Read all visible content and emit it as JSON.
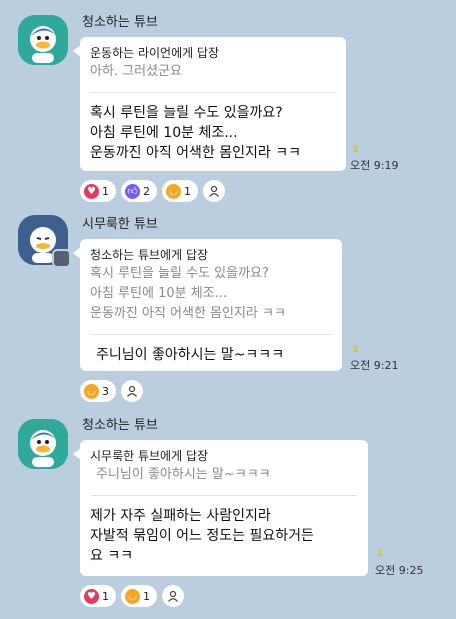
{
  "colors": {
    "background": "#bacee0",
    "bubble": "#ffffff",
    "unread": "#f2c100",
    "heart": "#e8385a",
    "like": "#7a5cf0",
    "laugh": "#f5a623"
  },
  "messages": [
    {
      "sender": "청소하는 튜브",
      "reply_to": "운동하는 라이언에게 답장",
      "quote": [
        "아하. 그러셨군요"
      ],
      "body": [
        "혹시 루틴을 늘릴 수도 있을까요?",
        "아침 루틴에 10분 체조...",
        "운동까진 아직 어색한 몸인지라 ㅋㅋ"
      ],
      "unread": "1",
      "time": "오전 9:19",
      "reactions": [
        {
          "icon": "heart-icon",
          "count": "1"
        },
        {
          "icon": "thumbs-up-icon",
          "count": "2"
        },
        {
          "icon": "laugh-icon",
          "count": "1"
        }
      ]
    },
    {
      "sender": "시무룩한 튜브",
      "reply_to": "청소하는 튜브에게 답장",
      "quote": [
        "혹시 루틴을 늘릴 수도 있을까요?",
        "아침 루틴에 10분 체조...",
        "운동까진 아직 어색한 몸인지라 ㅋㅋ"
      ],
      "body": [
        "주니님이 좋아하시는 말~ㅋㅋㅋ"
      ],
      "unread": "1",
      "time": "오전 9:21",
      "reactions": [
        {
          "icon": "laugh-icon",
          "count": "3"
        }
      ]
    },
    {
      "sender": "청소하는 튜브",
      "reply_to": "시무룩한 튜브에게 답장",
      "quote": [
        "주니님이 좋아하시는 말~ㅋㅋㅋ"
      ],
      "body": [
        "제가 자주 실패하는 사람인지라",
        "자발적 묶임이 어느 정도는 필요하거든",
        "요 ㅋㅋ"
      ],
      "unread": "1",
      "time": "오전 9:25",
      "reactions": [
        {
          "icon": "heart-icon",
          "count": "1"
        },
        {
          "icon": "laugh-icon",
          "count": "1"
        }
      ]
    }
  ]
}
